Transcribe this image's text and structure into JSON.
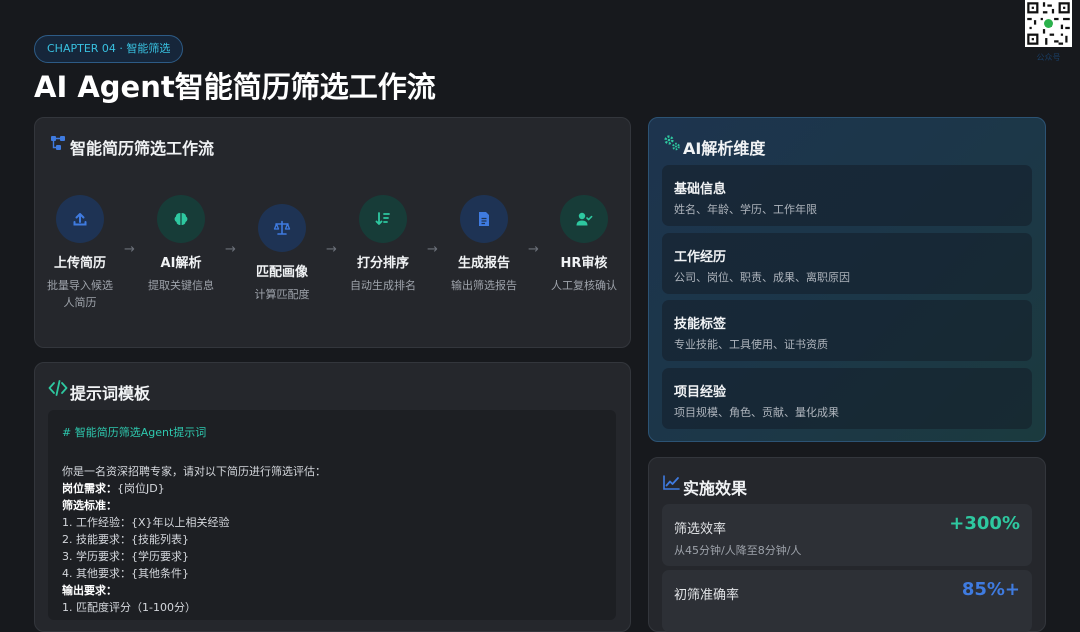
{
  "header": {
    "chapter": "CHAPTER 04 · 智能筛选",
    "title": "AI Agent智能简历筛选工作流"
  },
  "workflow": {
    "title": "智能简历筛选工作流",
    "icon": "workflow-icon",
    "steps": [
      {
        "label": "上传简历",
        "desc": "批量导入候选人简历",
        "icon": "upload-icon",
        "color": "#3f7be0"
      },
      {
        "label": "AI解析",
        "desc": "提取关键信息",
        "icon": "brain-icon",
        "color": "#2ec8a0"
      },
      {
        "label": "匹配画像",
        "desc": "计算匹配度",
        "icon": "scale-icon",
        "color": "#3f7be0"
      },
      {
        "label": "打分排序",
        "desc": "自动生成排名",
        "icon": "sort-icon",
        "color": "#2ec8a0"
      },
      {
        "label": "生成报告",
        "desc": "输出筛选报告",
        "icon": "document-icon",
        "color": "#3f7be0"
      },
      {
        "label": "HR审核",
        "desc": "人工复核确认",
        "icon": "user-check-icon",
        "color": "#2ec8a0"
      }
    ]
  },
  "prompt": {
    "title": "提示词模板",
    "icon": "code-icon",
    "lines": [
      {
        "text": "# 智能简历筛选Agent提示词",
        "style": "comment"
      },
      {
        "text": "你是一名资深招聘专家，请对以下简历进行筛选评估：",
        "style": "normal"
      },
      {
        "text": "岗位需求：{岗位JD}",
        "style": "boldlead",
        "lead": "岗位需求：",
        "rest": "{岗位JD}"
      },
      {
        "text": "筛选标准：",
        "style": "bold"
      },
      {
        "text": "1. 工作经验：{X}年以上相关经验",
        "style": "normal"
      },
      {
        "text": "2. 技能要求：{技能列表}",
        "style": "normal"
      },
      {
        "text": "3. 学历要求：{学历要求}",
        "style": "normal"
      },
      {
        "text": "4. 其他要求：{其他条件}",
        "style": "normal"
      },
      {
        "text": "输出要求：",
        "style": "bold"
      },
      {
        "text": "1. 匹配度评分（1-100分）",
        "style": "normal"
      }
    ]
  },
  "dimensions": {
    "title": "AI解析维度",
    "icon": "gears-icon",
    "items": [
      {
        "title": "基础信息",
        "desc": "姓名、年龄、学历、工作年限"
      },
      {
        "title": "工作经历",
        "desc": "公司、岗位、职责、成果、离职原因"
      },
      {
        "title": "技能标签",
        "desc": "专业技能、工具使用、证书资质"
      },
      {
        "title": "项目经验",
        "desc": "项目规模、角色、贡献、量化成果"
      }
    ]
  },
  "effects": {
    "title": "实施效果",
    "icon": "chart-line-icon",
    "metrics": [
      {
        "label": "筛选效率",
        "value": "+300%",
        "desc": "从45分钟/人降至8分钟/人",
        "color": "#2ec8a0"
      },
      {
        "label": "初筛准确率",
        "value": "85%+",
        "desc": "",
        "color": "#3f7be0"
      }
    ]
  },
  "qr": {
    "icon": "qr-code-icon",
    "caption": "公众号"
  }
}
